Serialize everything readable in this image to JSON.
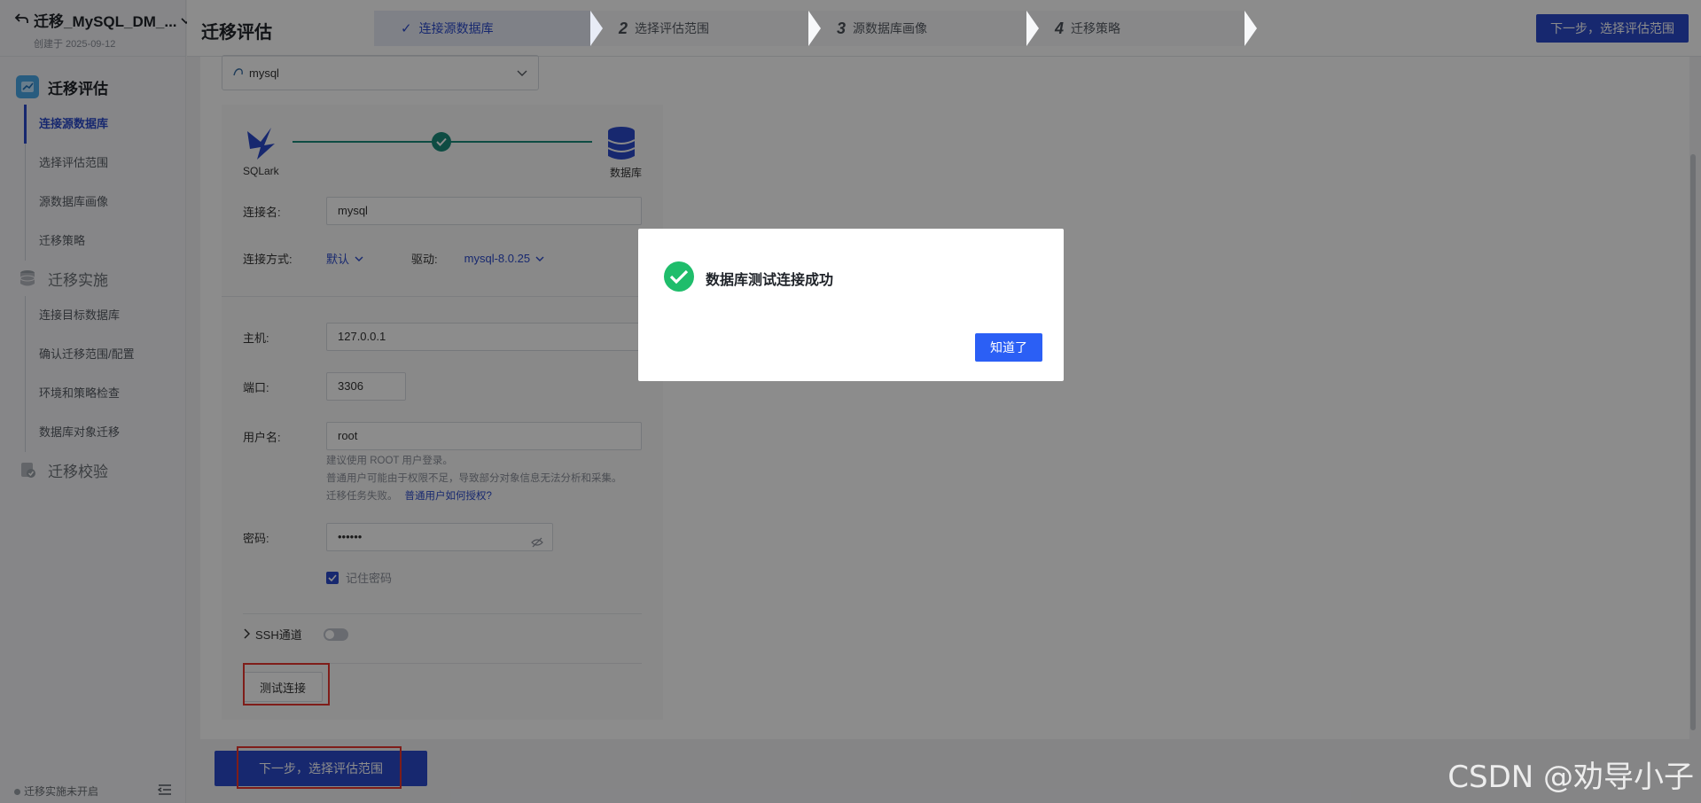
{
  "project": {
    "title": "迁移_MySQL_DM_...",
    "created": "创建于 2025-09-12"
  },
  "page": {
    "title": "迁移评估"
  },
  "steps": [
    {
      "num": "✓",
      "label": "连接源数据库"
    },
    {
      "num": "2",
      "label": "选择评估范围"
    },
    {
      "num": "3",
      "label": "源数据库画像"
    },
    {
      "num": "4",
      "label": "迁移策略"
    }
  ],
  "top_next": "下一步，选择评估范围",
  "sidebar": {
    "groups": [
      {
        "label": "迁移评估",
        "items": [
          "连接源数据库",
          "选择评估范围",
          "源数据库画像",
          "迁移策略"
        ]
      },
      {
        "label": "迁移实施",
        "items": [
          "连接目标数据库",
          "确认迁移范围/配置",
          "环境和策略检查",
          "数据库对象迁移"
        ]
      },
      {
        "label": "迁移校验",
        "items": []
      }
    ],
    "footer": "迁移实施未开启"
  },
  "source_select": "mysql",
  "visual": {
    "left": "SQLark",
    "right": "数据库"
  },
  "form": {
    "conn_name_label": "连接名:",
    "conn_name": "mysql",
    "method_label": "连接方式:",
    "method": "默认",
    "driver_label": "驱动:",
    "driver": "mysql-8.0.25",
    "host_label": "主机:",
    "host": "127.0.0.1",
    "port_label": "端口:",
    "port": "3306",
    "user_label": "用户名:",
    "user": "root",
    "hint1": "建议使用 ROOT 用户登录。",
    "hint2": "普通用户可能由于权限不足，导致部分对象信息无法分析和采集。",
    "hint3": "迁移任务失败。",
    "hint_link": "普通用户如何授权?",
    "pwd_label": "密码:",
    "pwd": "••••••",
    "remember": "记住密码",
    "ssh": "SSH通道",
    "test": "测试连接"
  },
  "bottom_next": "下一步，选择评估范围",
  "dialog": {
    "message": "数据库测试连接成功",
    "ok": "知道了"
  },
  "watermark": "CSDN @劝导小子",
  "colors": {
    "accent": "#2b4acb",
    "success": "#1fbd6b",
    "highlight": "#e8352e"
  }
}
